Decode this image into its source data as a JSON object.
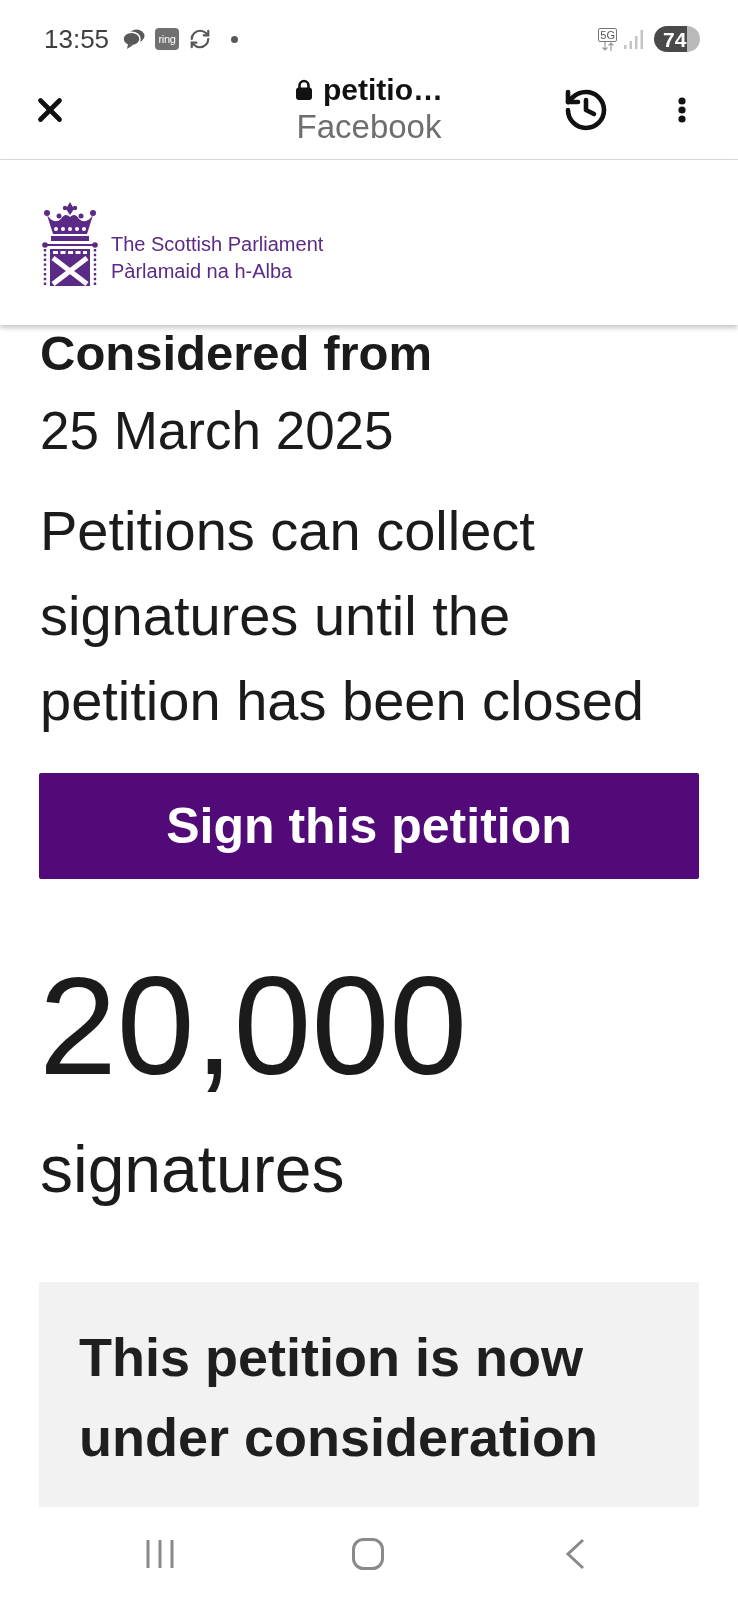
{
  "status_bar": {
    "time": "13:55",
    "notifications": [
      {
        "kind": "chat"
      },
      {
        "kind": "app_badge",
        "label": "ring"
      },
      {
        "kind": "sync"
      },
      {
        "kind": "dot"
      }
    ],
    "network": "5G",
    "battery": "74"
  },
  "browser_bar": {
    "title": "petitio…",
    "subtitle": "Facebook"
  },
  "site_header": {
    "logo_lines": [
      "The Scottish Parliament",
      "Pàrlamaid na h-Alba"
    ]
  },
  "petition": {
    "considered_label": "Considered from",
    "considered_date": "25 March 2025",
    "note": "Petitions can collect signatures until the petition has been closed",
    "sign_button": "Sign this petition",
    "signature_count": "20,000",
    "signature_label": "signatures",
    "status_panel": {
      "title": "This petition is now under consideration"
    }
  }
}
